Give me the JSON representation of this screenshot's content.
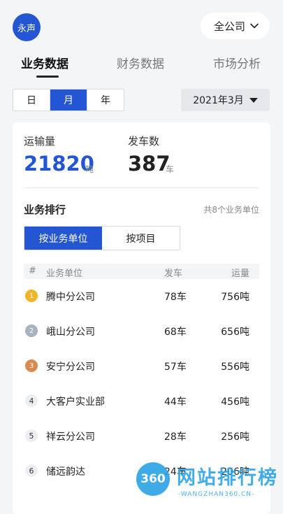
{
  "header": {
    "avatar_text": "永声",
    "company_selector": "全公司"
  },
  "tabs": [
    {
      "label": "业务数据",
      "active": true
    },
    {
      "label": "财务数据",
      "active": false
    },
    {
      "label": "市场分析",
      "active": false
    }
  ],
  "filters": {
    "periods": [
      "日",
      "月",
      "年"
    ],
    "active_period": "月",
    "month_value": "2021年3月"
  },
  "kpis": {
    "transport": {
      "label": "运输量",
      "value": "21820",
      "unit": "吨"
    },
    "departures": {
      "label": "发车数",
      "value": "387",
      "unit": "车"
    }
  },
  "ranking": {
    "title": "业务排行",
    "count_text": "共8个业务单位",
    "toggle": [
      "按业务单位",
      "按项目"
    ],
    "columns": [
      "#",
      "业务单位",
      "发车",
      "运量"
    ],
    "rows": [
      {
        "rank": "1",
        "unit": "腾中分公司",
        "departures": "78车",
        "volume": "756吨"
      },
      {
        "rank": "2",
        "unit": "峨山分公司",
        "departures": "68车",
        "volume": "656吨"
      },
      {
        "rank": "3",
        "unit": "安宁分公司",
        "departures": "57车",
        "volume": "556吨"
      },
      {
        "rank": "4",
        "unit": "大客户实业部",
        "departures": "44车",
        "volume": "456吨"
      },
      {
        "rank": "5",
        "unit": "祥云分公司",
        "departures": "28车",
        "volume": "256吨"
      },
      {
        "rank": "6",
        "unit": "储远韵达",
        "departures": "24车",
        "volume": "206吨"
      }
    ]
  },
  "watermark": {
    "logo_text": "360",
    "title": "网站排行榜",
    "subtitle": "-WANGZHAN360.CN-"
  },
  "colors": {
    "accent": "#2456d4",
    "gold": "#f0b52a",
    "silver": "#a9b2c0",
    "bronze": "#d98a4f"
  }
}
